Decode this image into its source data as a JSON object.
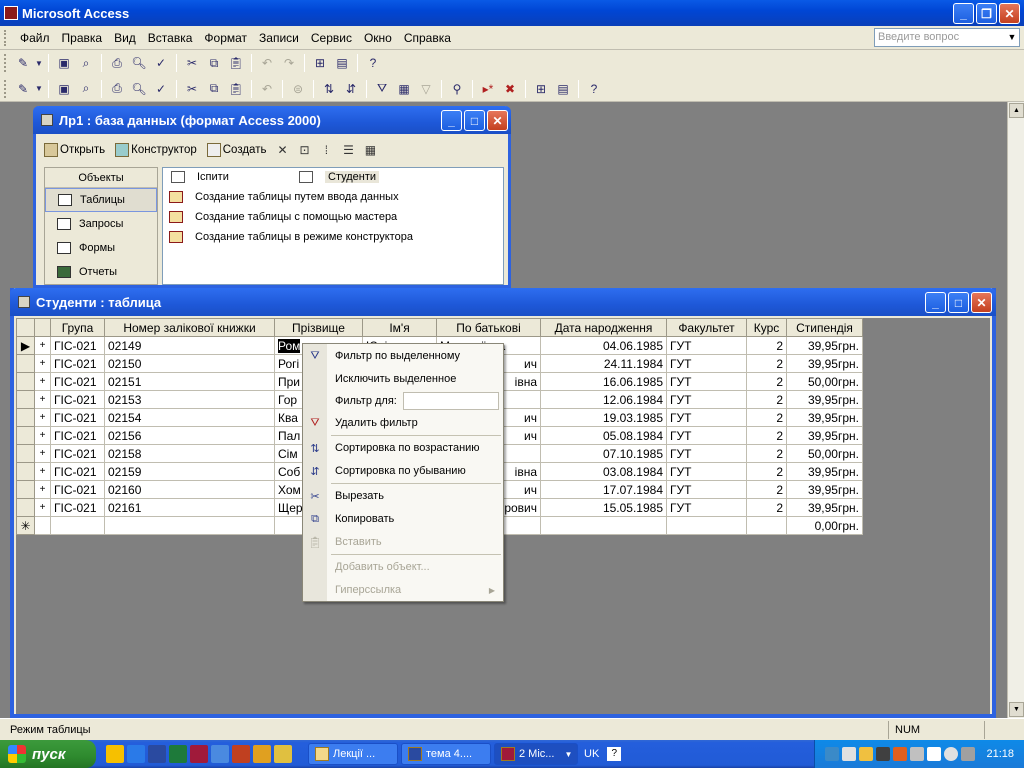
{
  "app": {
    "title": "Microsoft Access",
    "ask_placeholder": "Введите вопрос"
  },
  "menu": [
    "Файл",
    "Правка",
    "Вид",
    "Вставка",
    "Формат",
    "Записи",
    "Сервис",
    "Окно",
    "Справка"
  ],
  "toolbar1_icons": [
    "design-view-icon",
    "save-icon",
    "search-icon",
    "print-icon",
    "print-preview-icon",
    "spelling-icon",
    "cut-icon",
    "copy-icon",
    "paste-icon",
    "undo-icon",
    "redo-icon",
    "office-links-icon",
    "analyze-icon",
    "help-icon"
  ],
  "toolbar2_icons": [
    "view-icon",
    "save-icon",
    "search-icon",
    "print-icon",
    "print-preview-icon",
    "spelling-icon",
    "cut-icon",
    "copy-icon",
    "paste-icon",
    "format-painter-icon",
    "sort-ascending-icon",
    "sort-descending-icon",
    "filter-by-selection-icon",
    "filter-by-form-icon",
    "apply-filter-icon",
    "find-icon",
    "new-record-icon",
    "delete-record-icon",
    "database-window-icon",
    "new-object-icon",
    "help-icon"
  ],
  "db_window": {
    "title": "Лр1 : база данных (формат Access 2000)",
    "toolbar": {
      "open": "Открыть",
      "design": "Конструктор",
      "create": "Создать"
    },
    "objects_header": "Объекты",
    "objects": [
      "Таблицы",
      "Запросы",
      "Формы",
      "Отчеты"
    ],
    "items": {
      "table1": "Іспити",
      "table2": "Студенти",
      "create1": "Создание таблицы путем ввода данных",
      "create2": "Создание таблицы с помощью мастера",
      "create3": "Создание таблицы в режиме конструктора"
    }
  },
  "table_window": {
    "title": "Студенти : таблица",
    "columns": [
      "Група",
      "Номер залікової книжки",
      "Прізвище",
      "Ім'я",
      "По батькові",
      "Дата народження",
      "Факультет",
      "Курс",
      "Стипендія"
    ],
    "rows": [
      {
        "group": "ГІС-021",
        "num": "02149",
        "surname": "Ром",
        "name": "Юлі",
        "patronymic": "Миколаївна",
        "dob": "04.06.1985",
        "faculty": "ГУТ",
        "course": "2",
        "stipend": "39,95грн."
      },
      {
        "group": "ГІС-021",
        "num": "02150",
        "surname": "Рогі",
        "name": "",
        "patronymic": "ич",
        "dob": "24.11.1984",
        "faculty": "ГУТ",
        "course": "2",
        "stipend": "39,95грн."
      },
      {
        "group": "ГІС-021",
        "num": "02151",
        "surname": "При",
        "name": "",
        "patronymic": "івна",
        "dob": "16.06.1985",
        "faculty": "ГУТ",
        "course": "2",
        "stipend": "50,00грн."
      },
      {
        "group": "ГІС-021",
        "num": "02153",
        "surname": "Гор",
        "name": "",
        "patronymic": "",
        "dob": "12.06.1984",
        "faculty": "ГУТ",
        "course": "2",
        "stipend": "39,95грн."
      },
      {
        "group": "ГІС-021",
        "num": "02154",
        "surname": "Ква",
        "name": "",
        "patronymic": "ич",
        "dob": "19.03.1985",
        "faculty": "ГУТ",
        "course": "2",
        "stipend": "39,95грн."
      },
      {
        "group": "ГІС-021",
        "num": "02156",
        "surname": "Пал",
        "name": "",
        "patronymic": "ич",
        "dob": "05.08.1984",
        "faculty": "ГУТ",
        "course": "2",
        "stipend": "39,95грн."
      },
      {
        "group": "ГІС-021",
        "num": "02158",
        "surname": "Сім",
        "name": "",
        "patronymic": "",
        "dob": "07.10.1985",
        "faculty": "ГУТ",
        "course": "2",
        "stipend": "50,00грн."
      },
      {
        "group": "ГІС-021",
        "num": "02159",
        "surname": "Соб",
        "name": "",
        "patronymic": "івна",
        "dob": "03.08.1984",
        "faculty": "ГУТ",
        "course": "2",
        "stipend": "39,95грн."
      },
      {
        "group": "ГІС-021",
        "num": "02160",
        "surname": "Хом",
        "name": "",
        "patronymic": "ич",
        "dob": "17.07.1984",
        "faculty": "ГУТ",
        "course": "2",
        "stipend": "39,95грн."
      },
      {
        "group": "ГІС-021",
        "num": "02161",
        "surname": "Щер",
        "name": "",
        "patronymic": "рович",
        "dob": "15.05.1985",
        "faculty": "ГУТ",
        "course": "2",
        "stipend": "39,95грн."
      }
    ],
    "new_row_stipend": "0,00грн."
  },
  "context_menu": {
    "filter_by_selection": "Фильтр по выделенному",
    "exclude_selection": "Исключить выделенное",
    "filter_for": "Фильтр для:",
    "remove_filter": "Удалить фильтр",
    "sort_asc": "Сортировка по возрастанию",
    "sort_desc": "Сортировка по убыванию",
    "cut": "Вырезать",
    "copy": "Копировать",
    "paste": "Вставить",
    "insert_object": "Добавить объект...",
    "hyperlink": "Гиперссылка"
  },
  "status": {
    "mode": "Режим таблицы",
    "num": "NUM"
  },
  "taskbar": {
    "start": "пуск",
    "tasks": [
      "Лекції ...",
      "тема 4....",
      "2 Mic..."
    ],
    "lang": "UK",
    "clock": "21:18"
  },
  "colors": {
    "title_blue": "#0a4ad0",
    "taskbar_blue": "#245edc",
    "start_green": "#2e8a2e",
    "selection_black": "#000000"
  }
}
